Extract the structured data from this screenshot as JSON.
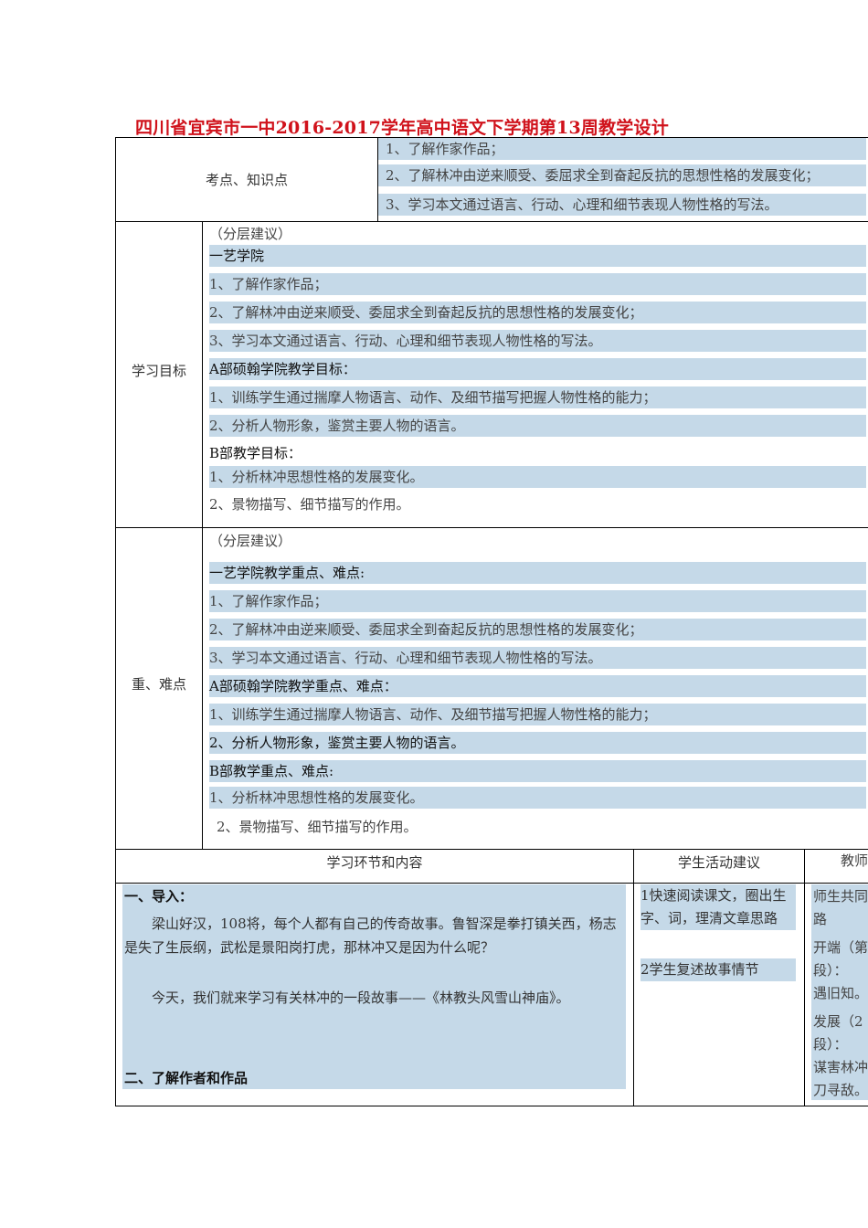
{
  "title": "四川省宜宾市一中2016-2017学年高中语文下学期第13周教学设计",
  "section1": {
    "label": "考点、知识点",
    "items": [
      "1、了解作家作品；",
      "2、了解林冲由逆来顺受、委屈求全到奋起反抗的思想性格的发展变化；",
      "3、学习本文通过语言、行动、心理和细节表现人物性格的写法。"
    ]
  },
  "section2": {
    "label": "学习目标",
    "note": "（分层建议）",
    "group1_title": "一艺学院",
    "group1_items": [
      "1、了解作家作品；",
      "2、了解林冲由逆来顺受、委屈求全到奋起反抗的思想性格的发展变化；",
      "3、学习本文通过语言、行动、心理和细节表现人物性格的写法。"
    ],
    "groupA_title": "A部硕翰学院教学目标：",
    "groupA_items": [
      "1、训练学生通过揣摩人物语言、动作、及细节描写把握人物性格的能力；",
      "2、分析人物形象，鉴赏主要人物的语言。"
    ],
    "groupB_title": "B部教学目标：",
    "groupB_items": [
      "1、分析林冲思想性格的发展变化。",
      "2、景物描写、细节描写的作用。"
    ]
  },
  "section3": {
    "label": "重、难点",
    "note": "（分层建议）",
    "group1_title": "一艺学院教学重点、难点:",
    "group1_items": [
      "1、了解作家作品；",
      "2、了解林冲由逆来顺受、委屈求全到奋起反抗的思想性格的发展变化；",
      "3、学习本文通过语言、行动、心理和细节表现人物性格的写法。"
    ],
    "groupA_title": "A部硕翰学院教学重点、难点：",
    "groupA_items": [
      "1、训练学生通过揣摩人物语言、动作、及细节描写把握人物性格的能力；",
      "2、分析人物形象，鉴赏主要人物的语言。"
    ],
    "groupB_title": "B部教学重点、难点:",
    "groupB_items": [
      "1、分析林冲思想性格的发展变化。",
      "2、景物描写、细节描写的作用。"
    ]
  },
  "section4": {
    "headers": [
      "学习环节和内容",
      "学生活动建议",
      "教师"
    ],
    "intro_title": "一、导入：",
    "intro_p1": "梁山好汉，108将，每个人都有自己的传奇故事。鲁智深是拳打镇关西，杨志是失了生辰纲，武松是景阳岗打虎，那林冲又是因为什么呢？",
    "intro_p2": "今天，我们就来学习有关林冲的一段故事——《林教头风雪山神庙》。",
    "part2_title": "二、了解作者和作品",
    "student_activities": [
      "1快速阅读课文，圈出生字、词，理清文章思路",
      "2学生复述故事情节"
    ],
    "teacher_lines": [
      "师生共同",
      "路",
      "开端（第",
      "段）：",
      "遇旧知。",
      "发展（2",
      "段）：",
      "谋害林冲",
      "刀寻敌。"
    ]
  }
}
